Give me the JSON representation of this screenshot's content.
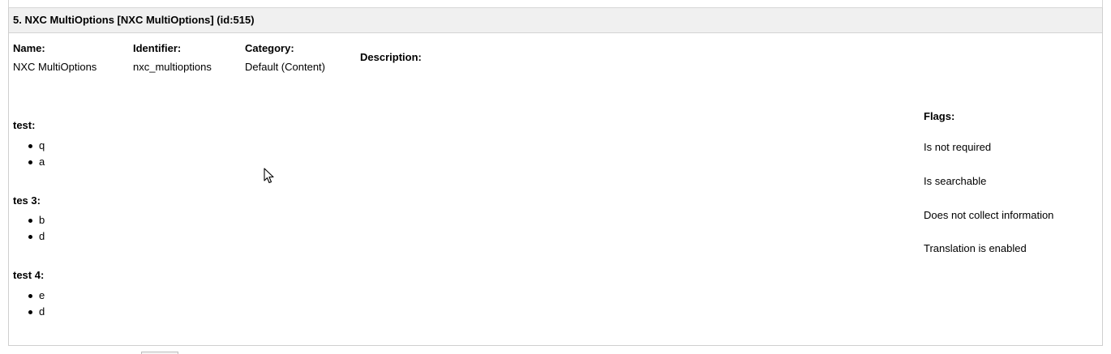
{
  "header": {
    "title": "5. NXC MultiOptions [NXC MultiOptions] (id:515)"
  },
  "fields": {
    "name": {
      "label": "Name:",
      "value": "NXC MultiOptions"
    },
    "identifier": {
      "label": "Identifier:",
      "value": "nxc_multioptions"
    },
    "category": {
      "label": "Category:",
      "value": "Default (Content)"
    },
    "description": {
      "label": "Description:"
    }
  },
  "option_groups": [
    {
      "title": "test:",
      "items": [
        "q",
        "a"
      ]
    },
    {
      "title": "tes 3:",
      "items": [
        "b",
        "d"
      ]
    },
    {
      "title": "test 4:",
      "items": [
        "e",
        "d"
      ]
    }
  ],
  "flags": {
    "title": "Flags:",
    "items": [
      "Is not required",
      "Is searchable",
      "Does not collect information",
      "Translation is enabled"
    ]
  },
  "icons": {
    "cursor": "mouse-pointer-icon"
  }
}
